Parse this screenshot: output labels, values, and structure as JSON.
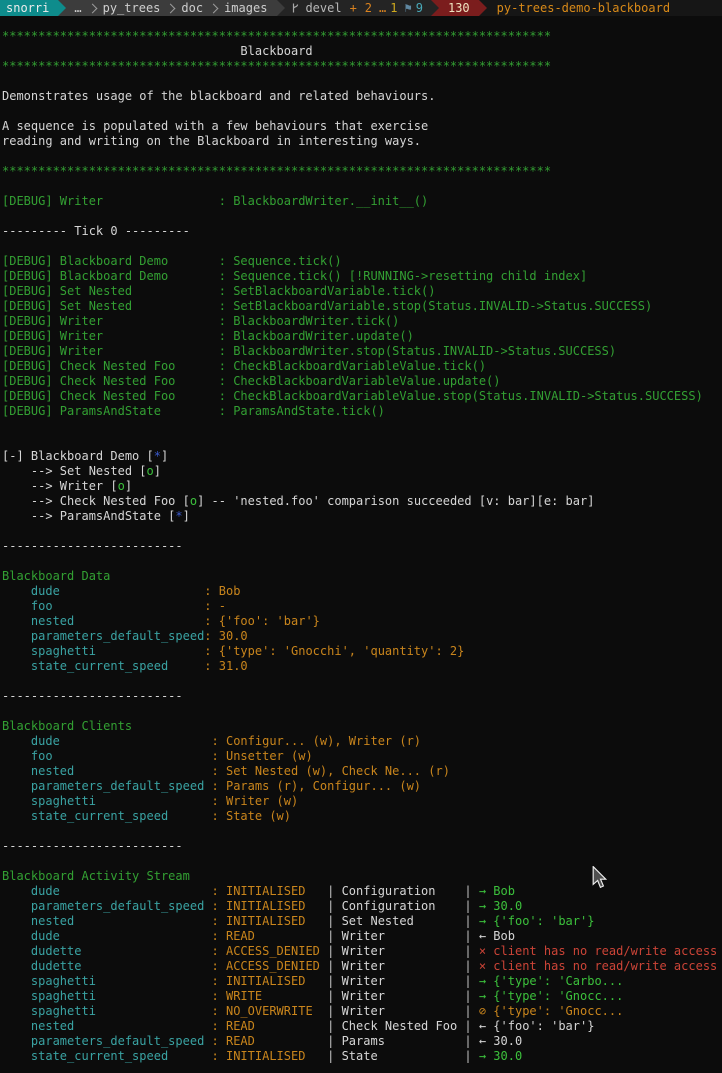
{
  "palette": {
    "bg": "#0c0c0c",
    "bar_bg": "#161616",
    "host_bg": "#0e8c8c",
    "path_bg": "#3c3c3c",
    "path_fg": "#cfcfcf",
    "sep_fg": "#9b9b9b",
    "git_bg": "#242424",
    "branch_fg": "#b8b8b8",
    "changed_fg": "#d9821f",
    "untracked_fg": "#cfa91e",
    "stash_icon_fg": "#5f87a0",
    "stash_fg": "#49a9b8",
    "exit_bg": "#7b1d1d",
    "exit_fg": "#efe3c0",
    "cmd_fg": "#d98a18",
    "green": "#33a033",
    "green_bright": "#3cc13c",
    "white": "#d6d6d6",
    "cyan": "#3aa3a3",
    "orange": "#c9851c",
    "red": "#cc4437",
    "blue": "#3b5bd0",
    "dim": "#c4c4c4"
  },
  "statusbar": {
    "host": "snorri",
    "path": [
      "…",
      "py_trees",
      "doc",
      "images"
    ],
    "git": {
      "branch": "devel",
      "changed_icon": "+",
      "changed_count": "2",
      "untracked_icon": "…",
      "untracked_count": "1",
      "stash_icon": "⚑",
      "stash_count": "9"
    },
    "exit_code": "130",
    "command": "py-trees-demo-blackboard"
  },
  "icons": {
    "git_branch": "branch-glyph-svg",
    "chevron_separator": "css-chevron",
    "powerline_arrow": "css-triangle",
    "stash": "⚑",
    "mouse_cursor": "arrow-pointer-svg"
  },
  "terminal": {
    "lines": [
      [
        [
          "g",
          "****************************************************************************"
        ]
      ],
      [
        [
          "w",
          "                                 Blackboard"
        ]
      ],
      [
        [
          "g",
          "****************************************************************************"
        ]
      ],
      [],
      [
        [
          "w",
          "Demonstrates usage of the blackboard and related behaviours."
        ]
      ],
      [],
      [
        [
          "w",
          "A sequence is populated with a few behaviours that exercise"
        ]
      ],
      [
        [
          "w",
          "reading and writing on the Blackboard in interesting ways."
        ]
      ],
      [],
      [
        [
          "g",
          "****************************************************************************"
        ]
      ],
      [],
      [
        [
          "g",
          "[DEBUG] Writer                : BlackboardWriter.__init__()"
        ]
      ],
      [],
      [
        [
          "w",
          "--------- Tick 0 ---------"
        ]
      ],
      [],
      [
        [
          "g",
          "[DEBUG] Blackboard Demo       : Sequence.tick()"
        ]
      ],
      [
        [
          "g",
          "[DEBUG] Blackboard Demo       : Sequence.tick() [!RUNNING->resetting child index]"
        ]
      ],
      [
        [
          "g",
          "[DEBUG] Set Nested            : SetBlackboardVariable.tick()"
        ]
      ],
      [
        [
          "g",
          "[DEBUG] Set Nested            : SetBlackboardVariable.stop(Status.INVALID->Status.SUCCESS)"
        ]
      ],
      [
        [
          "g",
          "[DEBUG] Writer                : BlackboardWriter.tick()"
        ]
      ],
      [
        [
          "g",
          "[DEBUG] Writer                : BlackboardWriter.update()"
        ]
      ],
      [
        [
          "g",
          "[DEBUG] Writer                : BlackboardWriter.stop(Status.INVALID->Status.SUCCESS)"
        ]
      ],
      [
        [
          "g",
          "[DEBUG] Check Nested Foo      : CheckBlackboardVariableValue.tick()"
        ]
      ],
      [
        [
          "g",
          "[DEBUG] Check Nested Foo      : CheckBlackboardVariableValue.update()"
        ]
      ],
      [
        [
          "g",
          "[DEBUG] Check Nested Foo      : CheckBlackboardVariableValue.stop(Status.INVALID->Status.SUCCESS)"
        ]
      ],
      [
        [
          "g",
          "[DEBUG] ParamsAndState        : ParamsAndState.tick()"
        ]
      ],
      [],
      [],
      [
        [
          "w",
          "[-] Blackboard Demo ["
        ],
        [
          "b",
          "*"
        ],
        [
          "w",
          "]"
        ]
      ],
      [
        [
          "w",
          "    --> Set Nested ["
        ],
        [
          "gb",
          "o"
        ],
        [
          "w",
          "]"
        ]
      ],
      [
        [
          "w",
          "    --> Writer ["
        ],
        [
          "gb",
          "o"
        ],
        [
          "w",
          "]"
        ]
      ],
      [
        [
          "w",
          "    --> Check Nested Foo ["
        ],
        [
          "gb",
          "o"
        ],
        [
          "w",
          "] -- 'nested.foo' comparison succeeded [v: bar][e: bar]"
        ]
      ],
      [
        [
          "w",
          "    --> ParamsAndState ["
        ],
        [
          "b",
          "*"
        ],
        [
          "w",
          "]"
        ]
      ],
      [],
      [
        [
          "w",
          "-------------------------"
        ]
      ],
      [],
      [
        [
          "g",
          "Blackboard Data"
        ]
      ],
      [
        [
          "c",
          "    dude                    "
        ],
        [
          "o",
          ": Bob"
        ]
      ],
      [
        [
          "c",
          "    foo                     "
        ],
        [
          "o",
          ": -"
        ]
      ],
      [
        [
          "c",
          "    nested                  "
        ],
        [
          "o",
          ": {'foo': 'bar'}"
        ]
      ],
      [
        [
          "c",
          "    parameters_default_speed"
        ],
        [
          "o",
          ": 30.0"
        ]
      ],
      [
        [
          "c",
          "    spaghetti               "
        ],
        [
          "o",
          ": {'type': 'Gnocchi', 'quantity': 2}"
        ]
      ],
      [
        [
          "c",
          "    state_current_speed     "
        ],
        [
          "o",
          ": 31.0"
        ]
      ],
      [],
      [
        [
          "w",
          "-------------------------"
        ]
      ],
      [],
      [
        [
          "g",
          "Blackboard Clients"
        ]
      ],
      [
        [
          "c",
          "    dude                    "
        ],
        [
          "o",
          " : Configur... (w), Writer (r)"
        ]
      ],
      [
        [
          "c",
          "    foo                     "
        ],
        [
          "o",
          " : Unsetter (w)"
        ]
      ],
      [
        [
          "c",
          "    nested                  "
        ],
        [
          "o",
          " : Set Nested (w), Check Ne... (r)"
        ]
      ],
      [
        [
          "c",
          "    parameters_default_speed"
        ],
        [
          "o",
          " : Params (r), Configur... (w)"
        ]
      ],
      [
        [
          "c",
          "    spaghetti               "
        ],
        [
          "o",
          " : Writer (w)"
        ]
      ],
      [
        [
          "c",
          "    state_current_speed     "
        ],
        [
          "o",
          " : State (w)"
        ]
      ],
      [],
      [
        [
          "w",
          "-------------------------"
        ]
      ],
      [],
      [
        [
          "g",
          "Blackboard Activity Stream"
        ]
      ],
      [
        [
          "c",
          "    dude                    "
        ],
        [
          "o",
          " : INITIALISED  "
        ],
        [
          "d",
          " | "
        ],
        [
          "w",
          "Configuration   "
        ],
        [
          "d",
          " | "
        ],
        [
          "gb",
          "→ Bob"
        ]
      ],
      [
        [
          "c",
          "    parameters_default_speed"
        ],
        [
          "o",
          " : INITIALISED  "
        ],
        [
          "d",
          " | "
        ],
        [
          "w",
          "Configuration   "
        ],
        [
          "d",
          " | "
        ],
        [
          "gb",
          "→ 30.0"
        ]
      ],
      [
        [
          "c",
          "    nested                  "
        ],
        [
          "o",
          " : INITIALISED  "
        ],
        [
          "d",
          " | "
        ],
        [
          "w",
          "Set Nested      "
        ],
        [
          "d",
          " | "
        ],
        [
          "gb",
          "→ {'foo': 'bar'}"
        ]
      ],
      [
        [
          "c",
          "    dude                    "
        ],
        [
          "o",
          " : READ         "
        ],
        [
          "d",
          " | "
        ],
        [
          "w",
          "Writer          "
        ],
        [
          "d",
          " | "
        ],
        [
          "w",
          "← Bob"
        ]
      ],
      [
        [
          "c",
          "    dudette                 "
        ],
        [
          "o",
          " : ACCESS_DENIED"
        ],
        [
          "d",
          " | "
        ],
        [
          "w",
          "Writer          "
        ],
        [
          "d",
          " | "
        ],
        [
          "r",
          "× client has no read/write access"
        ]
      ],
      [
        [
          "c",
          "    dudette                 "
        ],
        [
          "o",
          " : ACCESS_DENIED"
        ],
        [
          "d",
          " | "
        ],
        [
          "w",
          "Writer          "
        ],
        [
          "d",
          " | "
        ],
        [
          "r",
          "× client has no read/write access"
        ]
      ],
      [
        [
          "c",
          "    spaghetti               "
        ],
        [
          "o",
          " : INITIALISED  "
        ],
        [
          "d",
          " | "
        ],
        [
          "w",
          "Writer          "
        ],
        [
          "d",
          " | "
        ],
        [
          "gb",
          "→ {'type': 'Carbo..."
        ]
      ],
      [
        [
          "c",
          "    spaghetti               "
        ],
        [
          "o",
          " : WRITE        "
        ],
        [
          "d",
          " | "
        ],
        [
          "w",
          "Writer          "
        ],
        [
          "d",
          " | "
        ],
        [
          "gb",
          "→ {'type': 'Gnocc..."
        ]
      ],
      [
        [
          "c",
          "    spaghetti               "
        ],
        [
          "o",
          " : NO_OVERWRITE "
        ],
        [
          "d",
          " | "
        ],
        [
          "w",
          "Writer          "
        ],
        [
          "d",
          " | "
        ],
        [
          "o",
          "⊘ {'type': 'Gnocc..."
        ]
      ],
      [
        [
          "c",
          "    nested                  "
        ],
        [
          "o",
          " : READ         "
        ],
        [
          "d",
          " | "
        ],
        [
          "w",
          "Check Nested Foo"
        ],
        [
          "d",
          " | "
        ],
        [
          "w",
          "← {'foo': 'bar'}"
        ]
      ],
      [
        [
          "c",
          "    parameters_default_speed"
        ],
        [
          "o",
          " : READ         "
        ],
        [
          "d",
          " | "
        ],
        [
          "w",
          "Params          "
        ],
        [
          "d",
          " | "
        ],
        [
          "w",
          "← 30.0"
        ]
      ],
      [
        [
          "c",
          "    state_current_speed     "
        ],
        [
          "o",
          " : INITIALISED  "
        ],
        [
          "d",
          " | "
        ],
        [
          "w",
          "State           "
        ],
        [
          "d",
          " | "
        ],
        [
          "gb",
          "→ 30.0"
        ]
      ]
    ]
  }
}
